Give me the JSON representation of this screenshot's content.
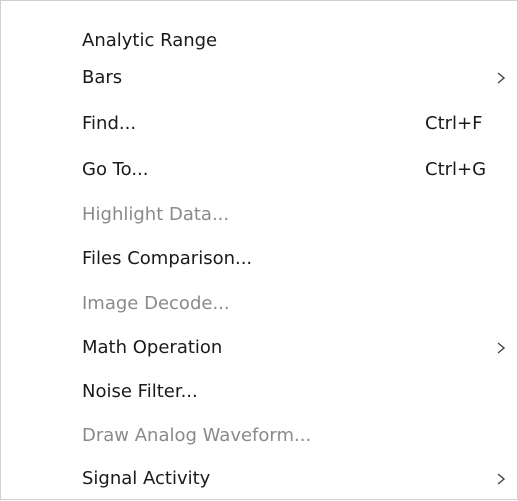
{
  "menu": {
    "items": [
      {
        "label": "Analytic Range",
        "shortcut": "",
        "submenu": false,
        "enabled": true
      },
      {
        "label": "Bars",
        "shortcut": "",
        "submenu": true,
        "enabled": true
      },
      {
        "label": "Find...",
        "shortcut": "Ctrl+F",
        "submenu": false,
        "enabled": true
      },
      {
        "label": "Go To...",
        "shortcut": "Ctrl+G",
        "submenu": false,
        "enabled": true
      },
      {
        "label": "Highlight Data...",
        "shortcut": "",
        "submenu": false,
        "enabled": false
      },
      {
        "label": "Files Comparison...",
        "shortcut": "",
        "submenu": false,
        "enabled": true
      },
      {
        "label": "Image Decode...",
        "shortcut": "",
        "submenu": false,
        "enabled": false
      },
      {
        "label": "Math Operation",
        "shortcut": "",
        "submenu": true,
        "enabled": true
      },
      {
        "label": "Noise Filter...",
        "shortcut": "",
        "submenu": false,
        "enabled": true
      },
      {
        "label": "Draw Analog Waveform...",
        "shortcut": "",
        "submenu": false,
        "enabled": false
      },
      {
        "label": "Signal Activity",
        "shortcut": "",
        "submenu": true,
        "enabled": true
      }
    ],
    "submenu_icon": "chevron-right-icon",
    "colors": {
      "enabled_text": "#1a1a1a",
      "disabled_text": "#8a8a8a",
      "border": "#d0d0d0",
      "background": "#ffffff"
    }
  }
}
